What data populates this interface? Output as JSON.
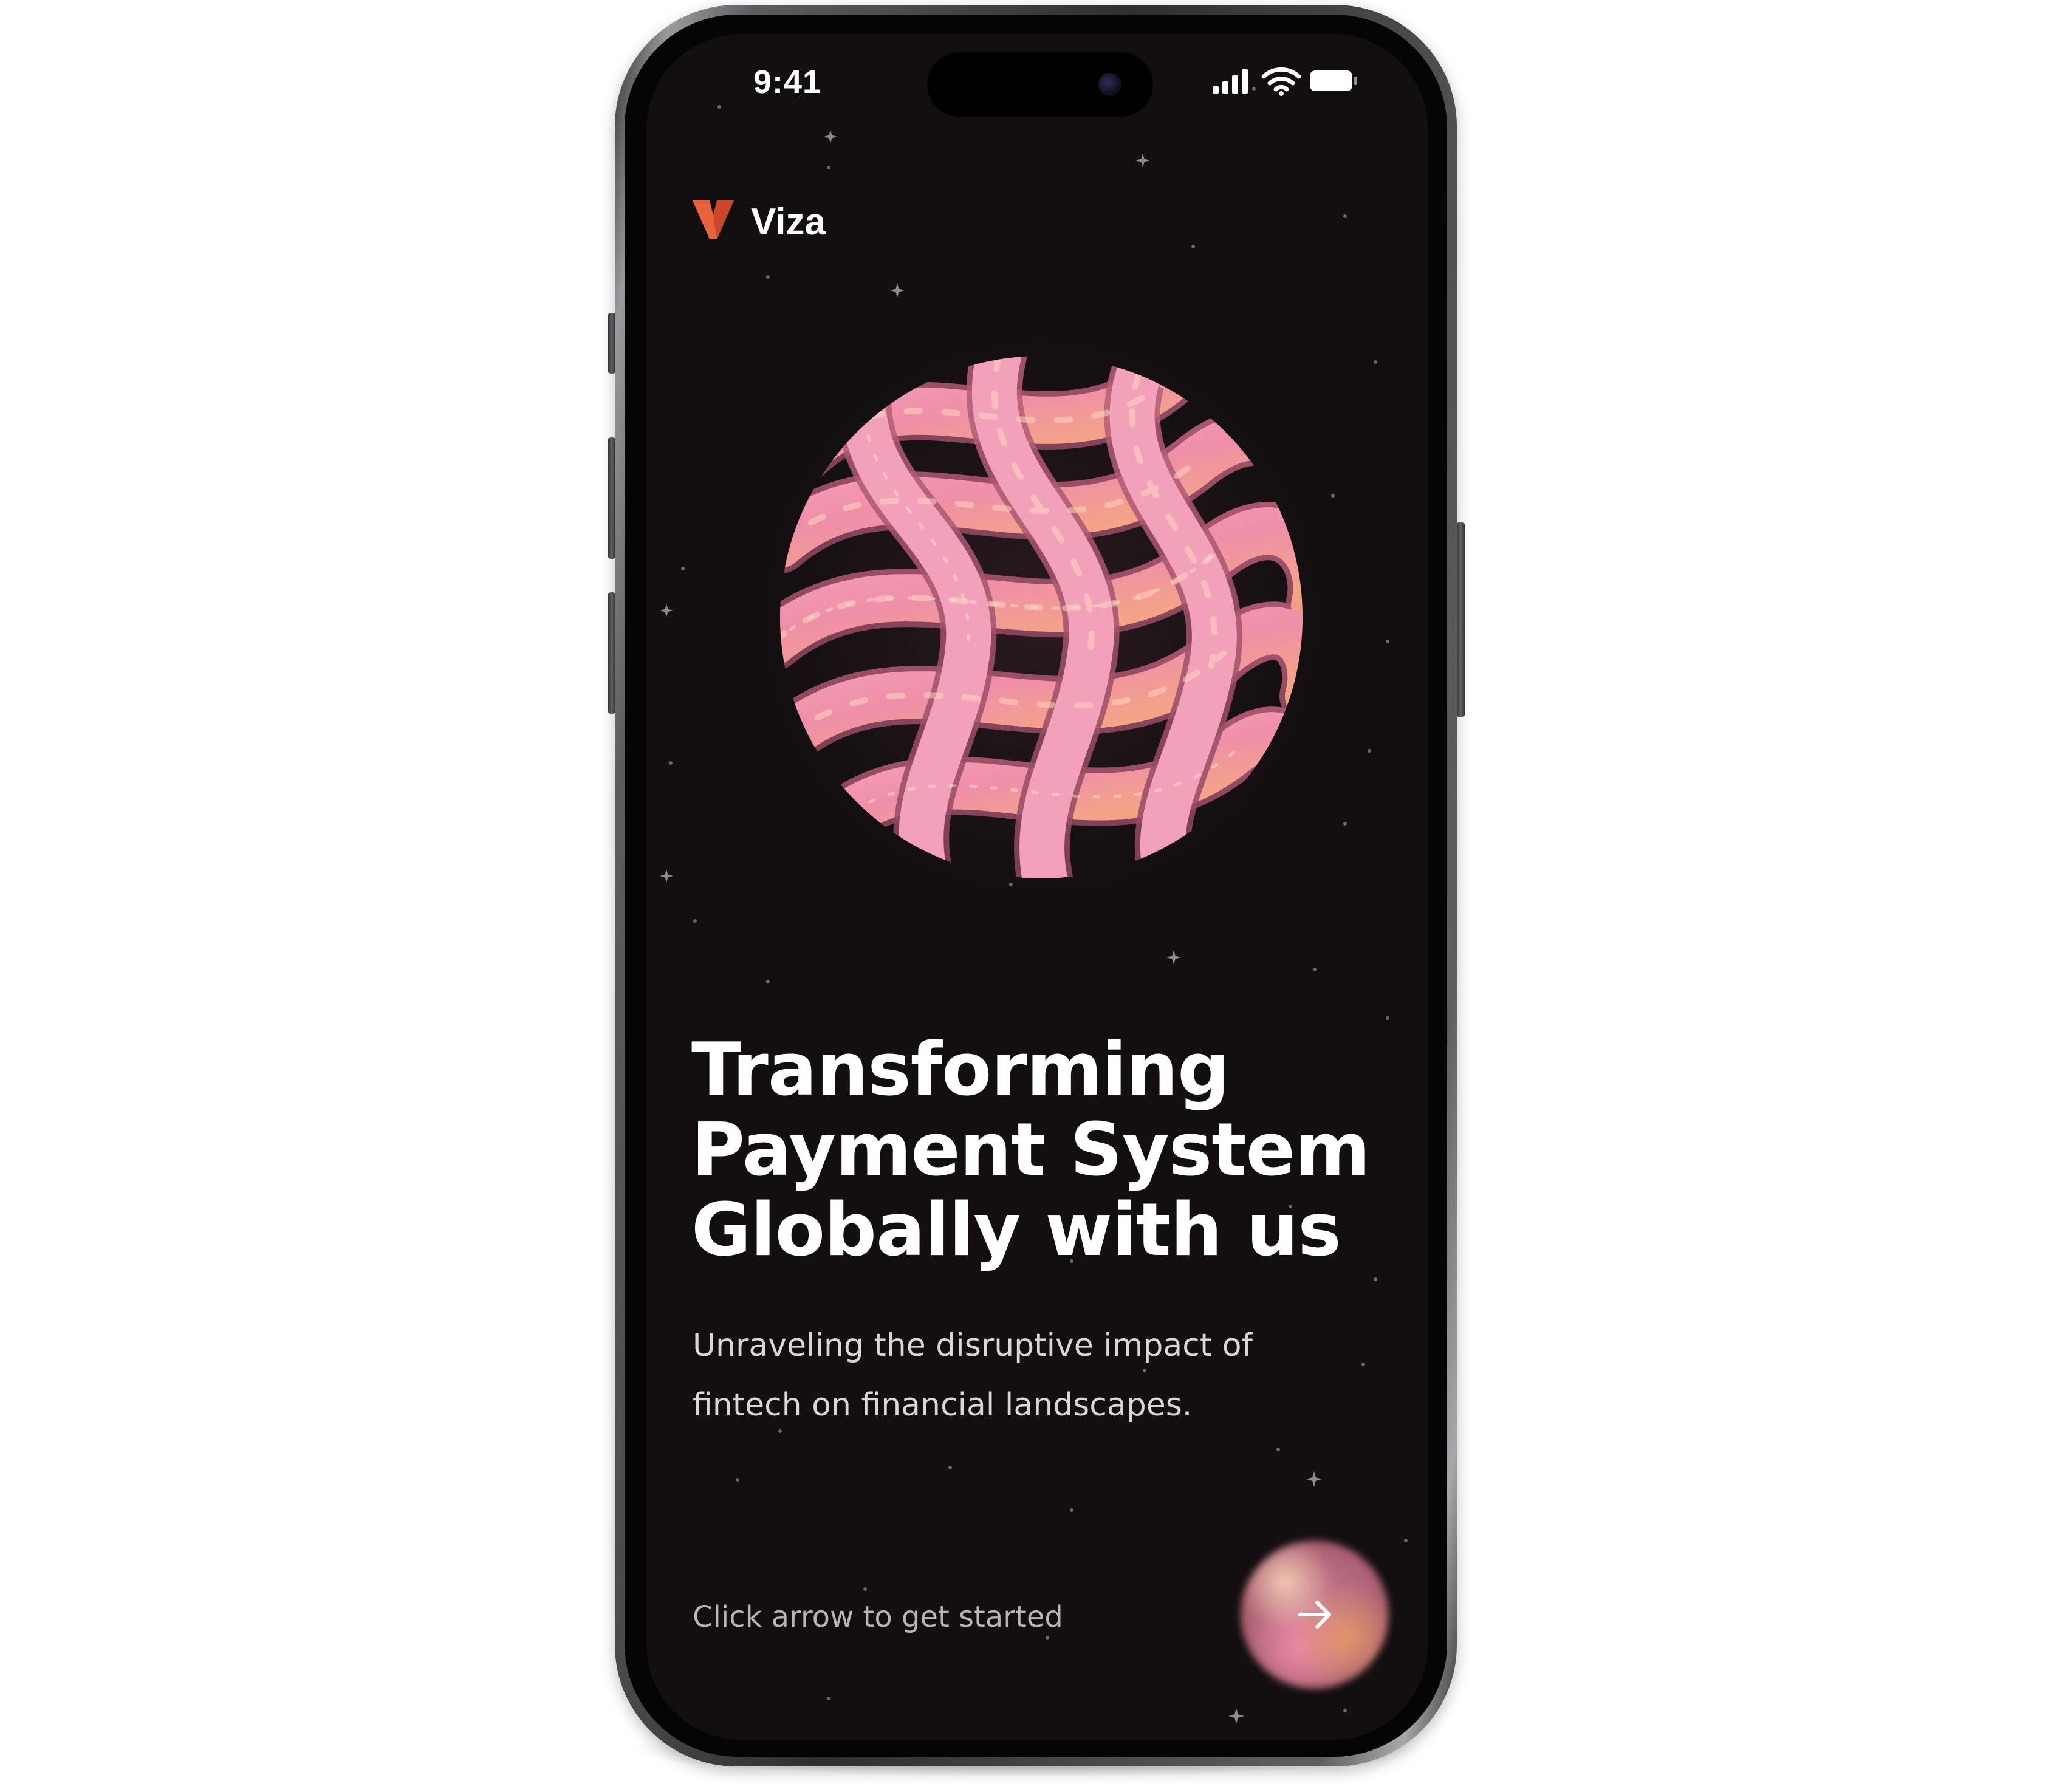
{
  "status_bar": {
    "time": "9:41",
    "icons": [
      "cellular-signal-icon",
      "wifi-icon",
      "battery-icon"
    ]
  },
  "brand": {
    "name": "Viza",
    "logo_icon": "v-logo-icon",
    "accent_color": "#e8623a"
  },
  "hero": {
    "illustration": "pink-3d-tube-sphere-icon",
    "headline_lines": [
      "Transforming",
      "Payment System",
      "Globally with us"
    ],
    "subtext_lines": [
      "Unraveling the disruptive impact of",
      "fintech on financial landscapes."
    ]
  },
  "cta": {
    "hint": "Click arrow to get started",
    "button_icon": "arrow-right-icon"
  },
  "colors": {
    "screen_background": "#130e10",
    "text_primary": "#ffffff",
    "text_secondary": "#dad6d7",
    "orb_pink": "#d7859b"
  }
}
